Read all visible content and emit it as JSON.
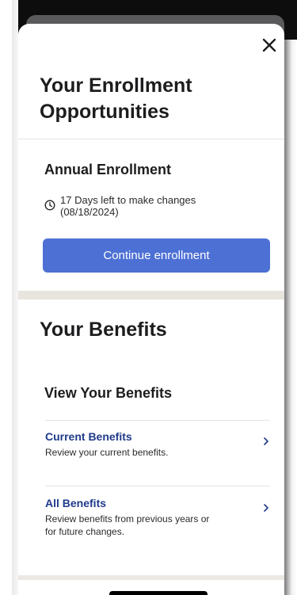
{
  "modal": {
    "close_label": "close",
    "enrollment": {
      "title": "Your Enrollment Opportunities",
      "annual_title": "Annual Enrollment",
      "deadline_line1": "17 Days left to make changes",
      "deadline_line2": "(08/18/2024)",
      "cta_label": "Continue enrollment"
    },
    "benefits": {
      "title": "Your Benefits",
      "view_title": "View Your Benefits",
      "items": [
        {
          "title": "Current Benefits",
          "description": "Review your current benefits."
        },
        {
          "title": "All Benefits",
          "description": "Review benefits from previous years or for future changes."
        }
      ]
    }
  },
  "colors": {
    "primary_button": "#4d70d4",
    "link_title": "#1f3a8a",
    "section_band": "#e8e4de"
  },
  "icons": {
    "close": "close-icon",
    "clock": "clock-icon",
    "chevron": "chevron-right-icon"
  }
}
